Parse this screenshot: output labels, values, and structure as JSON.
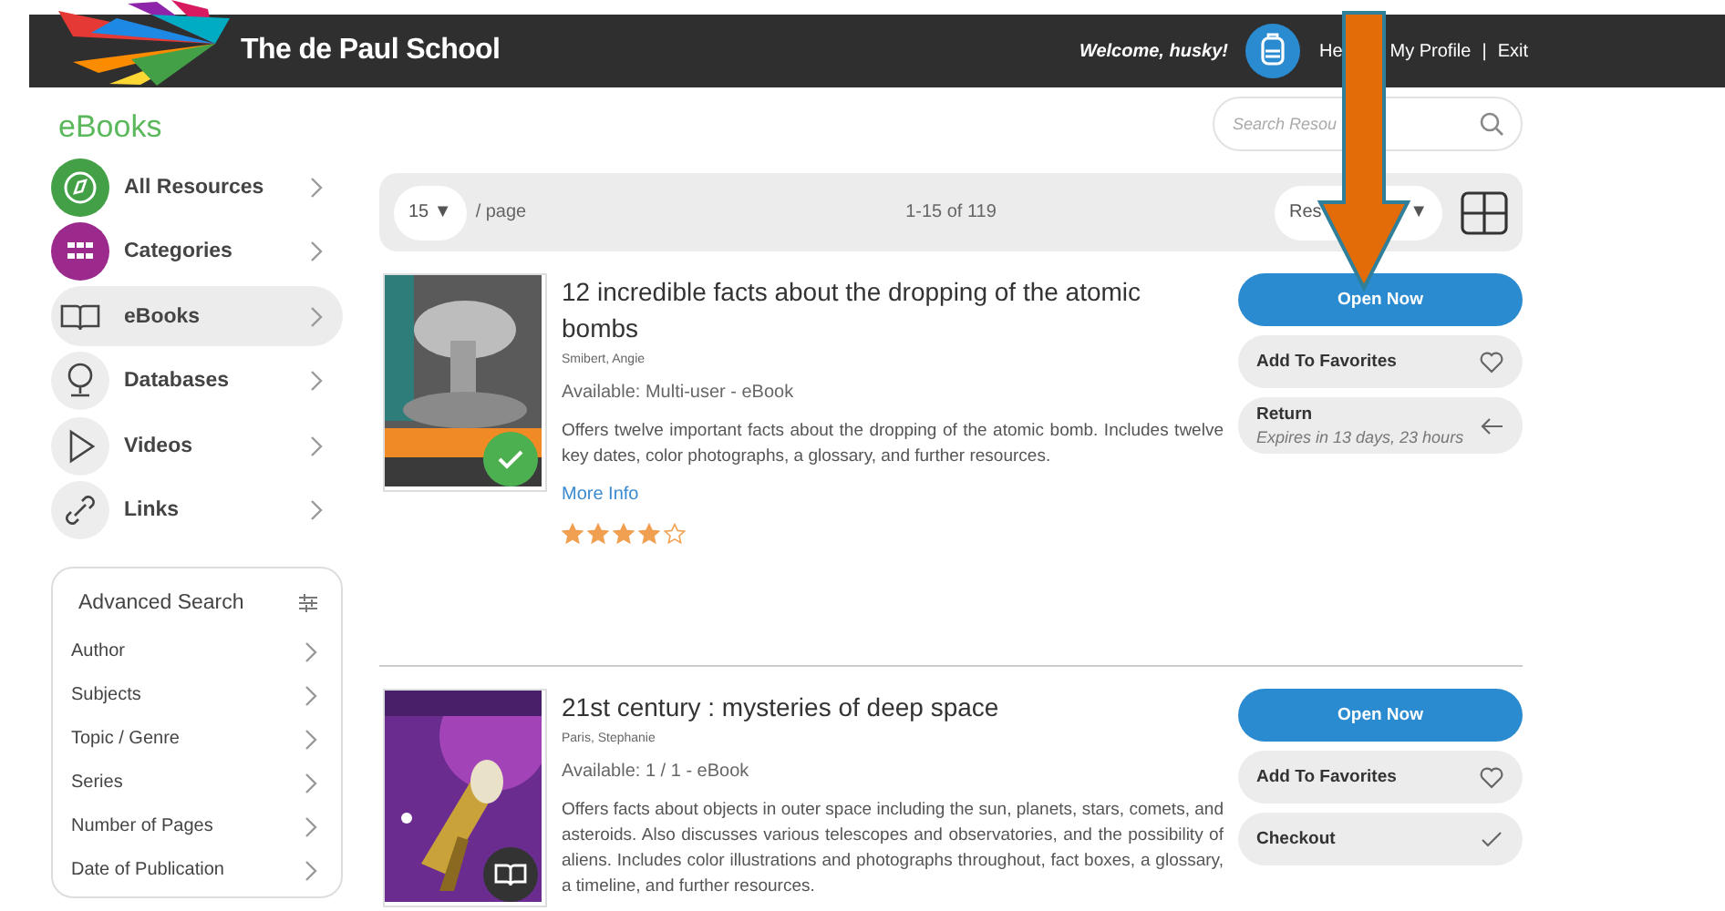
{
  "header": {
    "school": "The de Paul School",
    "welcome": "Welcome, husky!",
    "links": [
      "He",
      "My Profile",
      "Exit"
    ],
    "separator": "|"
  },
  "sidebar": {
    "title": "eBooks",
    "items": [
      {
        "label": "All Resources",
        "selected": false
      },
      {
        "label": "Categories",
        "selected": false
      },
      {
        "label": "eBooks",
        "selected": true
      },
      {
        "label": "Databases",
        "selected": false
      },
      {
        "label": "Videos",
        "selected": false
      },
      {
        "label": "Links",
        "selected": false
      }
    ]
  },
  "advanced_search": {
    "title": "Advanced Search",
    "filters": [
      "Author",
      "Subjects",
      "Topic / Genre",
      "Series",
      "Number of Pages",
      "Date of Publication"
    ]
  },
  "search": {
    "placeholder": "Search Resou"
  },
  "toolbar": {
    "per_page": "15 ▼",
    "per_page_label": "/ page",
    "range": "1-15 of 119",
    "sort": "Res",
    "sort_caret": "▼"
  },
  "items": [
    {
      "title": "12 incredible facts about the dropping of the atomic bombs",
      "author": "Smibert, Angie",
      "availability": "Available: Multi-user - eBook",
      "description": "Offers twelve important facts about the dropping of the atomic bomb. Includes twelve key dates, color photographs, a glossary, and further resources.",
      "more_info": "More Info",
      "stars": 4,
      "actions": [
        {
          "kind": "primary",
          "label": "Open Now"
        },
        {
          "kind": "favorite",
          "label": "Add To Favorites"
        },
        {
          "kind": "return",
          "label": "Return",
          "note": "Expires in 13 days, 23 hours"
        }
      ]
    },
    {
      "title": "21st century : mysteries of deep space",
      "author": "Paris, Stephanie",
      "availability": "Available: 1 / 1 - eBook",
      "description": "Offers facts about objects in outer space including the sun, planets, stars, comets, and asteroids. Also discusses various telescopes and observatories, and the possibility of aliens. Includes color illustrations and photographs throughout, fact boxes, a glossary, a timeline, and further resources.",
      "actions": [
        {
          "kind": "primary",
          "label": "Open Now"
        },
        {
          "kind": "favorite",
          "label": "Add To Favorites"
        },
        {
          "kind": "checkout",
          "label": "Checkout"
        }
      ]
    }
  ]
}
